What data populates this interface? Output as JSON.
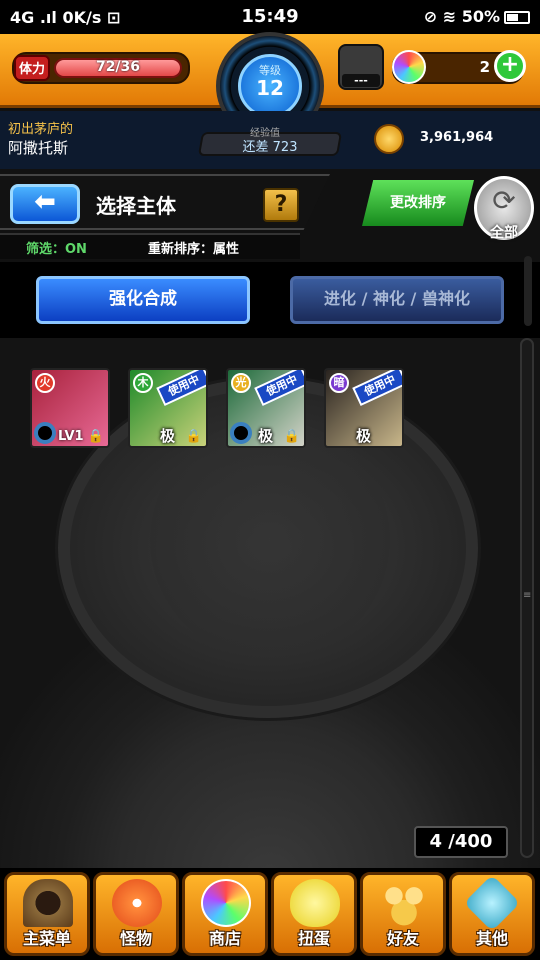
{
  "statusbar": {
    "left": "4G .ıl 0K/s ⊡",
    "time": "15:49",
    "right": "⊘ ≋ 50%"
  },
  "header": {
    "stamina_label": "体力",
    "stamina_value": "72/36",
    "level_label": "等级",
    "level": "12",
    "exp_label": "经验值",
    "exp_text": "还差 723",
    "egg_text": "---",
    "gems": "2",
    "gems_add": "+",
    "coins": "3,961,964"
  },
  "player": {
    "title": "初出茅庐的",
    "name": "阿撒托斯"
  },
  "page": {
    "back": "⬅",
    "title": "选择主体",
    "help": "?",
    "filter": "筛选：ON",
    "sort_label": "重新排序：属性",
    "sort_button": "更改排序",
    "all_button": "全部",
    "refresh_icon": "⟳"
  },
  "tabs": {
    "fusion": "强化合成",
    "evolve": "进化 / 神化 / 兽神化"
  },
  "cards": [
    {
      "element": "fire",
      "element_symbol": "火",
      "level": "LV1",
      "in_use": "",
      "max": "",
      "locked": true,
      "colors": [
        "#a8223c",
        "#e86a96"
      ]
    },
    {
      "element": "wood",
      "element_symbol": "木",
      "level": "",
      "in_use": "使用中",
      "max": "极",
      "locked": true,
      "colors": [
        "#1e8a2a",
        "#c9d27a"
      ]
    },
    {
      "element": "light",
      "element_symbol": "光",
      "level": "",
      "in_use": "使用中",
      "max": "极",
      "locked": true,
      "colors": [
        "#1d6a3a",
        "#d3d3c8"
      ]
    },
    {
      "element": "dark",
      "element_symbol": "暗",
      "level": "",
      "in_use": "使用中",
      "max": "极",
      "locked": false,
      "colors": [
        "#2a2420",
        "#c8b68a"
      ]
    }
  ],
  "inventory": {
    "count": "4 /400"
  },
  "nav": [
    {
      "label": "主菜单",
      "icon": "home-icon",
      "color": "#6b4a2a"
    },
    {
      "label": "怪物",
      "icon": "monster-icon",
      "color": "#e24a1a"
    },
    {
      "label": "商店",
      "icon": "orb-shop-icon",
      "color": "#rainbow"
    },
    {
      "label": "扭蛋",
      "icon": "egg-gacha-icon",
      "color": "#f2e24a"
    },
    {
      "label": "好友",
      "icon": "friends-icon",
      "color": "#f6c94a"
    },
    {
      "label": "其他",
      "icon": "other-icon",
      "color": "#4ab4c6"
    }
  ]
}
